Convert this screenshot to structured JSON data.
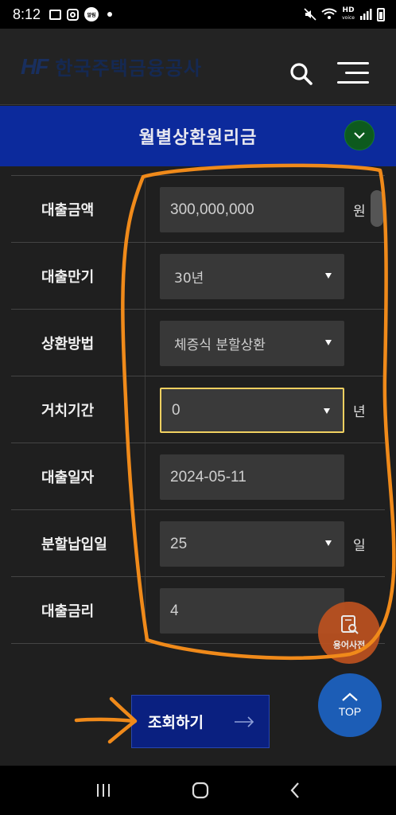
{
  "status_bar": {
    "time": "8:12",
    "badge_text": "알림",
    "hd_label_top": "HD",
    "hd_label_bottom": "voice"
  },
  "header": {
    "logo_mark": "HF",
    "logo_text": "한국주택금융공사",
    "brand_color": "#0b2f7a"
  },
  "title_bar": {
    "title": "월별상환원리금",
    "background": "#0c2a9c"
  },
  "form": {
    "rows": [
      {
        "label": "대출금액",
        "value": "300,000,000",
        "unit": "원",
        "type": "input"
      },
      {
        "label": "대출만기",
        "value": "30년",
        "unit": "",
        "type": "select"
      },
      {
        "label": "상환방법",
        "value": "체증식 분할상환",
        "unit": "",
        "type": "select"
      },
      {
        "label": "거치기간",
        "value": "0",
        "unit": "년",
        "type": "select"
      },
      {
        "label": "대출일자",
        "value": "2024-05-11",
        "unit": "",
        "type": "input"
      },
      {
        "label": "분할납입일",
        "value": "25",
        "unit": "일",
        "type": "select"
      },
      {
        "label": "대출금리",
        "value": "4",
        "unit": "",
        "type": "input"
      }
    ]
  },
  "floating": {
    "dictionary_label": "용어사전",
    "top_label": "TOP"
  },
  "submit": {
    "label": "조회하기"
  },
  "colors": {
    "accent_blue": "#0c2a9c",
    "focus_border": "#f0d060",
    "annotation_orange": "#f08a1a",
    "dict_button": "#c0521f",
    "top_button": "#1c5db6"
  }
}
